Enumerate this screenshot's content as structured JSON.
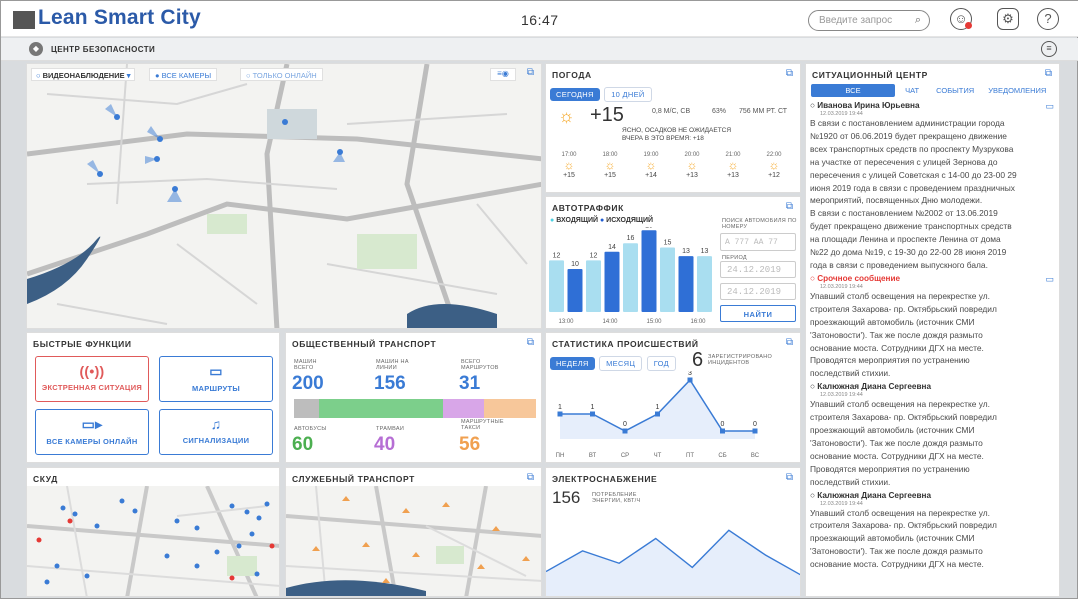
{
  "app": {
    "title": "Lean Smart City",
    "time": "16:47",
    "search_placeholder": "Введите запрос"
  },
  "subheader": {
    "title": "ЦЕНТР БЕЗОПАСНОСТИ"
  },
  "video": {
    "dropdown": "ВИДЕОНАБЛЮДЕНИЕ",
    "opt_all": "ВСЕ КАМЕРЫ",
    "opt_online": "ТОЛЬКО ОНЛАЙН"
  },
  "weather": {
    "title": "ПОГОДА",
    "tabs": [
      "СЕГОДНЯ",
      "10 ДНЕЙ"
    ],
    "temp": "+15",
    "wind": "0,8 М/С, СВ",
    "humidity": "63%",
    "pressure": "756 ММ РТ. СТ",
    "desc1": "ЯСНО, ОСАДКОВ НЕ ОЖИДАЕТСЯ",
    "desc2": "ВЧЕРА В ЭТО ВРЕМЯ: +18",
    "hours": [
      {
        "t": "17:00",
        "v": "+15"
      },
      {
        "t": "18:00",
        "v": "+15"
      },
      {
        "t": "19:00",
        "v": "+14"
      },
      {
        "t": "20:00",
        "v": "+13"
      },
      {
        "t": "21:00",
        "v": "+13"
      },
      {
        "t": "22:00",
        "v": "+12"
      }
    ]
  },
  "traffic": {
    "title": "АВТОТРАФФИК",
    "legend_in": "ВХОДЯЩИЙ",
    "legend_out": "ИСХОДЯЩИЙ",
    "search_label": "ПОИСК АВТОМОБИЛЯ ПО НОМЕРУ",
    "plate_placeholder": "А 777 АА 77",
    "period_label": "ПЕРИОД",
    "date_from": "24.12.2019",
    "date_to": "24.12.2019",
    "find_button": "НАЙТИ"
  },
  "situation": {
    "title": "СИТУАЦИОННЫЙ ЦЕНТР",
    "tabs": [
      "ВСЕ",
      "ЧАТ",
      "СОБЫТИЯ",
      "УВЕДОМЛЕНИЯ"
    ],
    "messages": [
      {
        "author": "Иванова Ирина Юрьевна",
        "date": "12.03.2019 19:44",
        "urgent": false,
        "lines": [
          "В связи с постановлением администрации города",
          "№1920 от 06.06.2019 будет прекращено движение",
          "всех транспортных средств по проспекту Музрукова",
          "на участке от пересечения с улицей Зернова до",
          "пересечения с улицей Советская с 14-00 до 23-00 29",
          "июня 2019 года в связи с проведением праздничных",
          "мероприятий, посвященных Дню молодежи.",
          "В связи с постановлением №2002 от 13.06.2019",
          "будет прекращено движение транспортных средств",
          "на площади Ленина и проспекте Ленина от дома",
          "№22 до дома №19, с 19-30 до 22-00 28 июня 2019",
          "года в связи с проведением выпускного бала."
        ]
      },
      {
        "author": "Срочное сообщение",
        "date": "12.03.2019 19:44",
        "urgent": true,
        "lines": [
          "Упавший столб освещения на перекрестке ул.",
          "строителя Захарова- пр. Октябрьский повредил",
          "проезжающий автомобиль (источник СМИ",
          "'Затоновости'). Так же после дождя размыто",
          "основание моста. Сотрудники ДГХ на месте.",
          "Проводятся мероприятия по устранению",
          "последствий стихии."
        ]
      },
      {
        "author": "Калюжная Диана Сергеевна",
        "date": "12.03.2019 19:44",
        "urgent": false,
        "lines": [
          "Упавший столб освещения на перекрестке ул.",
          "строителя Захарова- пр. Октябрьский повредил",
          "проезжающий автомобиль (источник СМИ",
          "'Затоновости'). Так же после дождя размыто",
          "основание моста. Сотрудники ДГХ на месте.",
          "Проводятся мероприятия по устранению",
          "последствий стихии."
        ]
      },
      {
        "author": "Калюжная Диана Сергеевна",
        "date": "12.03.2019 19:44",
        "urgent": false,
        "lines": [
          "Упавший столб освещения на перекрестке ул.",
          "строителя Захарова- пр. Октябрьский повредил",
          "проезжающий автомобиль (источник СМИ",
          "'Затоновости'). Так же после дождя размыто",
          "основание моста. Сотрудники ДГХ на месте."
        ]
      }
    ]
  },
  "quick": {
    "title": "БЫСТРЫЕ ФУНКЦИИ",
    "emergency": "ЭКСТРЕННАЯ СИТУАЦИЯ",
    "routes": "МАРШРУТЫ",
    "cameras": "ВСЕ КАМЕРЫ ОНЛАЙН",
    "alarms": "СИГНАЛИЗАЦИИ"
  },
  "transport": {
    "title": "ОБЩЕСТВЕННЫЙ ТРАНСПОРТ",
    "cars_total_label": "МАШИН ВСЕГО",
    "cars_total": "200",
    "cars_line_label": "МАШИН НА ЛИНИИ",
    "cars_line": "156",
    "routes_label": "ВСЕГО МАРШРУТОВ",
    "routes": "31",
    "bus_label": "АВТОБУСЫ",
    "bus": "60",
    "tram_label": "ТРАМВАИ",
    "tram": "40",
    "taxi_label": "МАРШРУТНЫЕ ТАКСИ",
    "taxi": "56",
    "colors": {
      "bus": "#4caf50",
      "tram": "#9c27b0",
      "taxi": "#f5a623"
    }
  },
  "incidents": {
    "title": "СТАТИСТИКА ПРОИСШЕСТВИЙ",
    "tabs": [
      "НЕДЕЛЯ",
      "МЕСЯЦ",
      "ГОД"
    ],
    "count": "6",
    "count_label": "ЗАРЕГИСТРИРОВАНО ИНЦИДЕНТОВ"
  },
  "skud": {
    "title": "СКУД"
  },
  "service": {
    "title": "СЛУЖЕБНЫЙ ТРАНСПОРТ"
  },
  "power": {
    "title": "ЭЛЕКТРОСНАБЖЕНИЕ",
    "value": "156",
    "label": "ПОТРЕБЛЕНИЕ ЭНЕРГИИ, КВТ/Ч"
  },
  "chart_data": [
    {
      "type": "bar",
      "title": "АВТОТРАФФИК",
      "x_ticks": [
        "13:00",
        "14:00",
        "15:00",
        "16:00"
      ],
      "series": [
        {
          "name": "ВХОДЯЩИЙ",
          "values": [
            12,
            12,
            16,
            15,
            13
          ]
        },
        {
          "name": "ИСХОДЯЩИЙ",
          "values": [
            10,
            14,
            19,
            13
          ]
        }
      ],
      "ylim": [
        0,
        20
      ]
    },
    {
      "type": "line",
      "title": "СТАТИСТИКА ПРОИСШЕСТВИЙ",
      "categories": [
        "ПН",
        "ВТ",
        "СР",
        "ЧТ",
        "ПТ",
        "СБ",
        "ВС"
      ],
      "values": [
        1,
        1,
        0,
        1,
        3,
        0,
        0
      ],
      "ylim": [
        0,
        3
      ]
    },
    {
      "type": "area",
      "title": "ЭЛЕКТРОСНАБЖЕНИЕ",
      "values": [
        4,
        9,
        6,
        12,
        5,
        14,
        8,
        3
      ]
    }
  ]
}
